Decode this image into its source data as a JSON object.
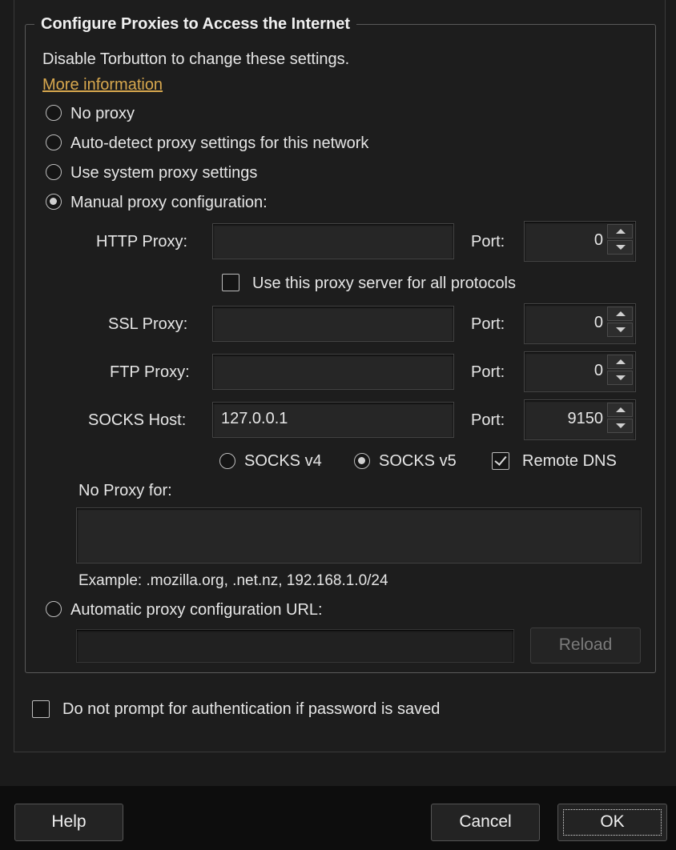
{
  "frame": {
    "legend": "Configure Proxies to Access the Internet",
    "info_text": "Disable Torbutton to change these settings.",
    "more_info_link": "More information"
  },
  "proxy_modes": {
    "no_proxy": "No proxy",
    "auto_detect": "Auto-detect proxy settings for this network",
    "system": "Use system proxy settings",
    "manual": "Manual proxy configuration:",
    "selected": "manual"
  },
  "manual": {
    "http_label": "HTTP Proxy:",
    "http_value": "",
    "http_port_label": "Port:",
    "http_port": "0",
    "share_all_label": "Use this proxy server for all protocols",
    "share_all_checked": false,
    "ssl_label": "SSL Proxy:",
    "ssl_value": "",
    "ssl_port_label": "Port:",
    "ssl_port": "0",
    "ftp_label": "FTP Proxy:",
    "ftp_value": "",
    "ftp_port_label": "Port:",
    "ftp_port": "0",
    "socks_label": "SOCKS Host:",
    "socks_value": "127.0.0.1",
    "socks_port_label": "Port:",
    "socks_port": "9150",
    "socks_v4_label": "SOCKS v4",
    "socks_v5_label": "SOCKS v5",
    "socks_version_selected": "v5",
    "remote_dns_label": "Remote DNS",
    "remote_dns_checked": true,
    "no_proxy_label": "No Proxy for:",
    "no_proxy_value": "",
    "example_text": "Example: .mozilla.org, .net.nz, 192.168.1.0/24"
  },
  "auto_config": {
    "label": "Automatic proxy configuration URL:",
    "url_value": "",
    "reload_label": "Reload"
  },
  "auth": {
    "label": "Do not prompt for authentication if password is saved",
    "checked": false
  },
  "buttons": {
    "help": "Help",
    "cancel": "Cancel",
    "ok": "OK"
  },
  "colors": {
    "background": "#1b1b1b",
    "link": "#d8a84e",
    "text": "#e6e6e6"
  }
}
